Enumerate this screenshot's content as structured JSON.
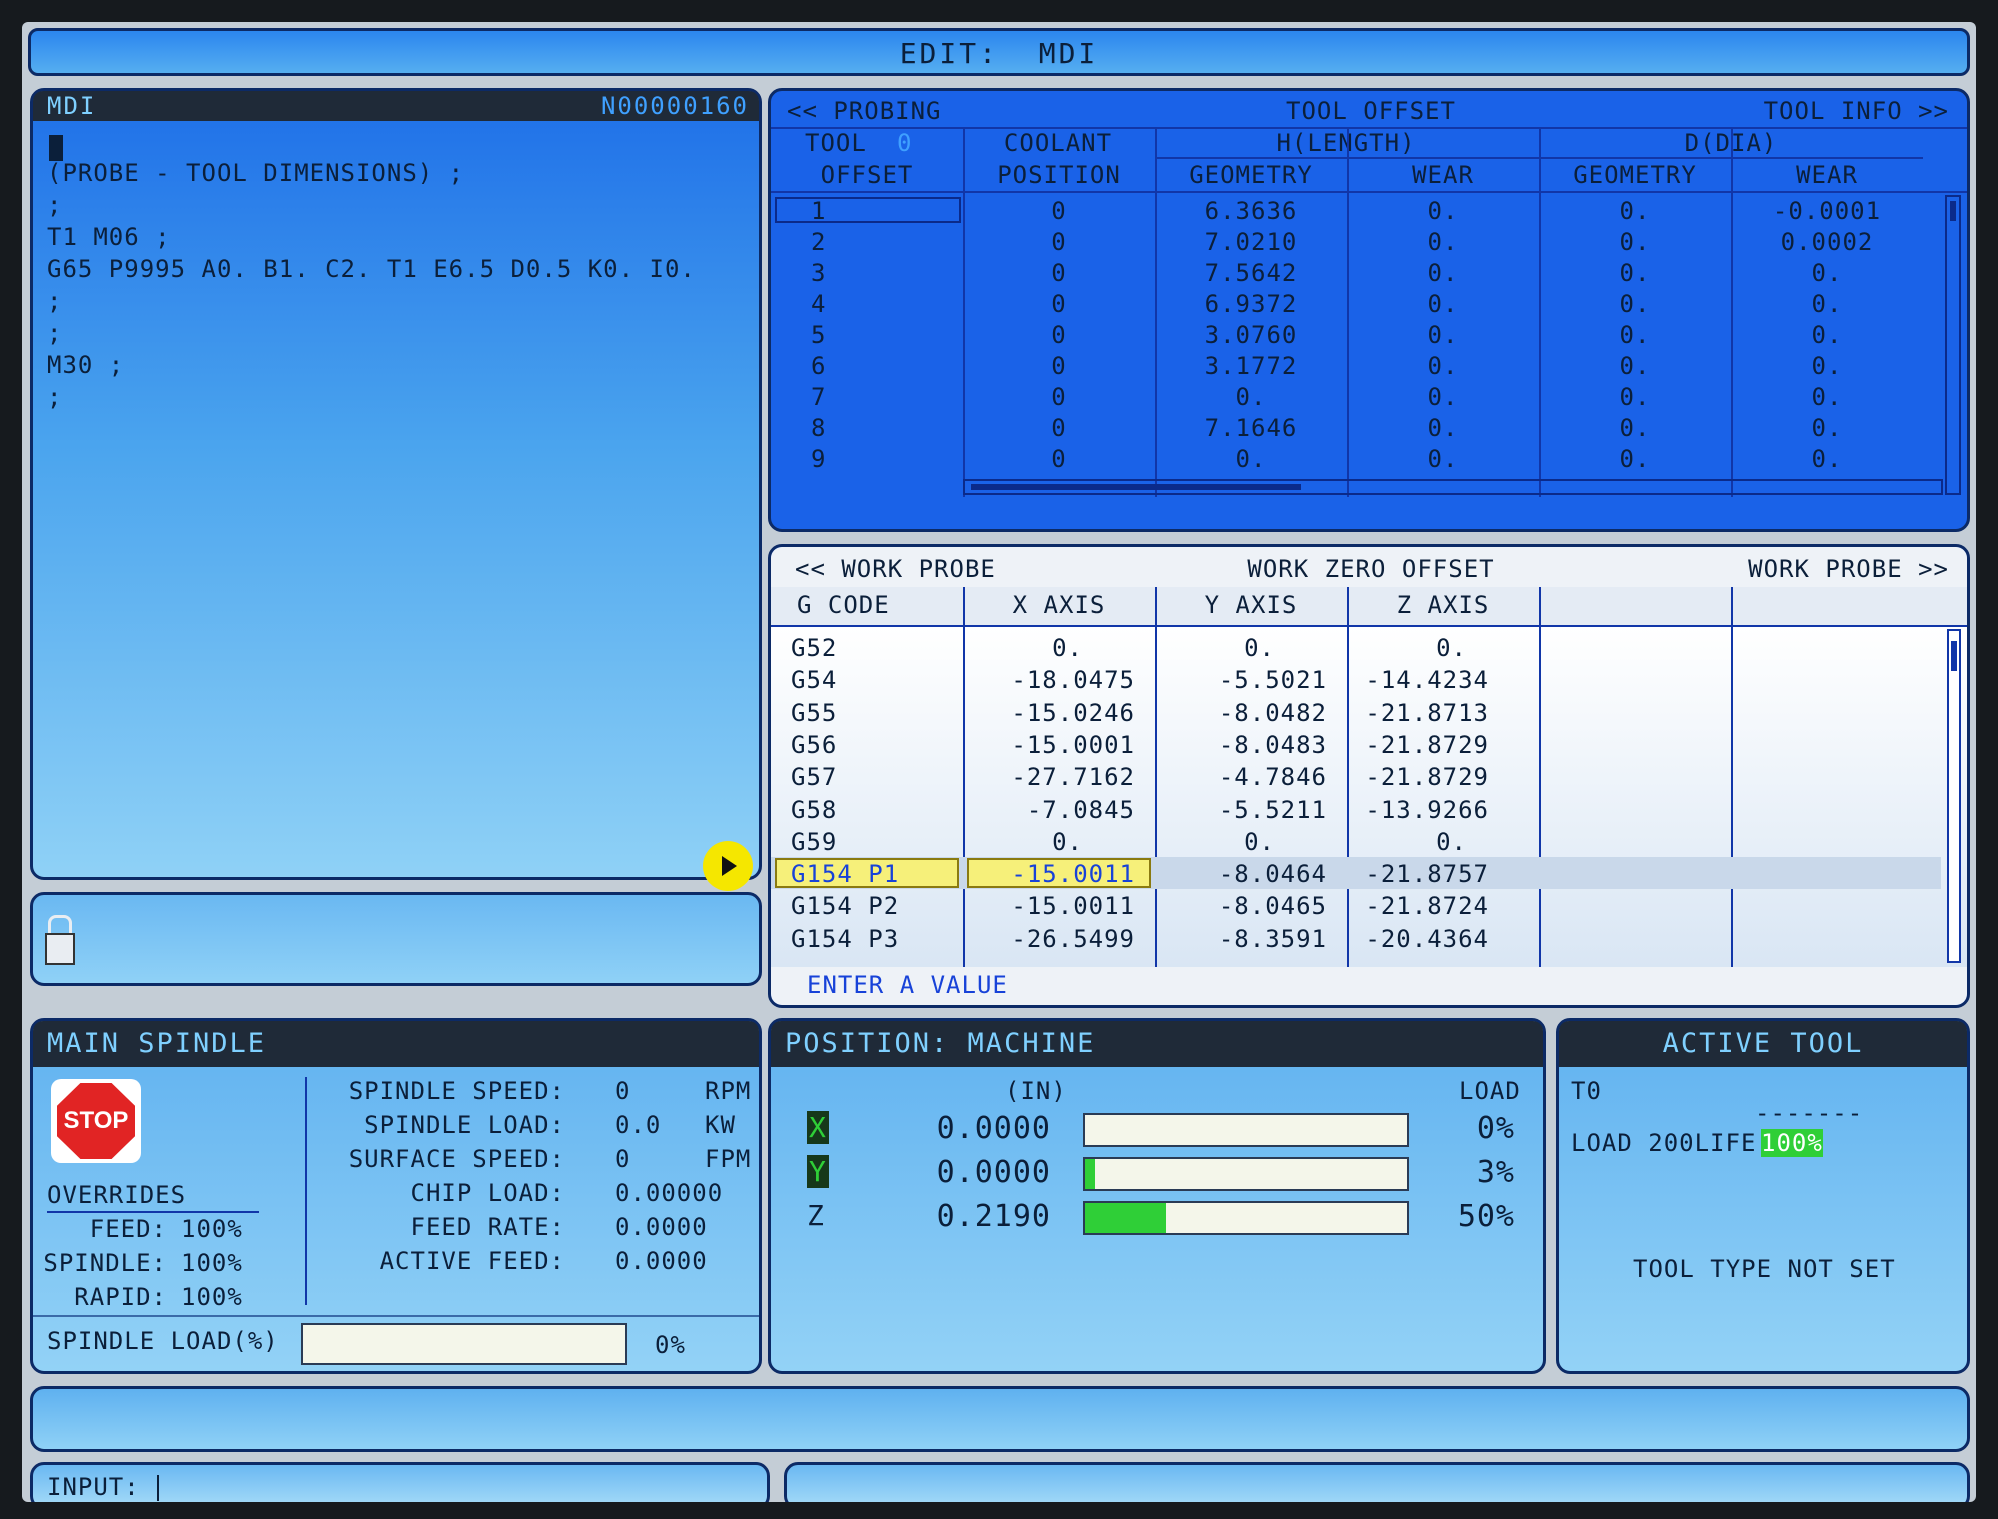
{
  "title": "EDIT:  MDI",
  "mdi": {
    "label": "MDI",
    "program_number": "N00000160",
    "lines": [
      "(PROBE - TOOL DIMENSIONS) ;",
      ";",
      "T1 M06 ;",
      "G65 P9995 A0. B1. C2. T1 E6.5 D0.5 K0. I0.",
      ";",
      ";",
      "M30 ;",
      ";"
    ],
    "play_icon": "play-icon",
    "lock_icon": "lock-icon"
  },
  "tool_offset": {
    "nav_left": "<< PROBING",
    "title": "TOOL OFFSET",
    "nav_right": "TOOL INFO >>",
    "tool_label": "TOOL",
    "tool_value": "0",
    "h_label": "H(LENGTH)",
    "d_label": "D(DIA)",
    "columns": [
      "OFFSET",
      "POSITION",
      "GEOMETRY",
      "WEAR",
      "GEOMETRY",
      "WEAR"
    ],
    "coolant_label": "COOLANT",
    "rows": [
      [
        "1",
        "0",
        "6.3636",
        "0.",
        "0.",
        "-0.0001"
      ],
      [
        "2",
        "0",
        "7.0210",
        "0.",
        "0.",
        "0.0002"
      ],
      [
        "3",
        "0",
        "7.5642",
        "0.",
        "0.",
        "0."
      ],
      [
        "4",
        "0",
        "6.9372",
        "0.",
        "0.",
        "0."
      ],
      [
        "5",
        "0",
        "3.0760",
        "0.",
        "0.",
        "0."
      ],
      [
        "6",
        "0",
        "3.1772",
        "0.",
        "0.",
        "0."
      ],
      [
        "7",
        "0",
        "0.",
        "0.",
        "0.",
        "0."
      ],
      [
        "8",
        "0",
        "7.1646",
        "0.",
        "0.",
        "0."
      ],
      [
        "9",
        "0",
        "0.",
        "0.",
        "0.",
        "0."
      ]
    ]
  },
  "work_offset": {
    "nav_left": "<< WORK PROBE",
    "title": "WORK ZERO OFFSET",
    "nav_right": "WORK PROBE >>",
    "columns": [
      "G CODE",
      "X AXIS",
      "Y AXIS",
      "Z AXIS"
    ],
    "rows": [
      [
        "G52",
        "0.",
        "0.",
        "0."
      ],
      [
        "G54",
        "-18.0475",
        "-5.5021",
        "-14.4234"
      ],
      [
        "G55",
        "-15.0246",
        "-8.0482",
        "-21.8713"
      ],
      [
        "G56",
        "-15.0001",
        "-8.0483",
        "-21.8729"
      ],
      [
        "G57",
        "-27.7162",
        "-4.7846",
        "-21.8729"
      ],
      [
        "G58",
        "-7.0845",
        "-5.5211",
        "-13.9266"
      ],
      [
        "G59",
        "0.",
        "0.",
        "0."
      ],
      [
        "G154 P1",
        "-15.0011",
        "-8.0464",
        "-21.8757"
      ],
      [
        "G154 P2",
        "-15.0011",
        "-8.0465",
        "-21.8724"
      ],
      [
        "G154 P3",
        "-26.5499",
        "-8.3591",
        "-20.4364"
      ]
    ],
    "selected_row": 7,
    "prompt": "ENTER A VALUE"
  },
  "spindle": {
    "title": "MAIN SPINDLE",
    "stop_label": "STOP",
    "overrides_label": "OVERRIDES",
    "overrides": [
      {
        "label": "FEED:",
        "value": "100%"
      },
      {
        "label": "SPINDLE:",
        "value": "100%"
      },
      {
        "label": "RAPID:",
        "value": "100%"
      }
    ],
    "stats": [
      {
        "label": "SPINDLE SPEED:",
        "value": "0",
        "unit": "RPM"
      },
      {
        "label": "SPINDLE LOAD:",
        "value": "0.0",
        "unit": "KW"
      },
      {
        "label": "SURFACE SPEED:",
        "value": "0",
        "unit": "FPM"
      },
      {
        "label": "CHIP LOAD:",
        "value": "0.00000",
        "unit": ""
      },
      {
        "label": "FEED RATE:",
        "value": "0.0000",
        "unit": ""
      },
      {
        "label": "ACTIVE FEED:",
        "value": "0.0000",
        "unit": ""
      }
    ],
    "load_label": "SPINDLE LOAD(%)",
    "load_value": "0%",
    "load_fraction": 0
  },
  "position": {
    "title": "POSITION:  MACHINE",
    "unit_label": "(IN)",
    "load_label": "LOAD",
    "axes": [
      {
        "axis": "X",
        "value": "0.0000",
        "load": "0%",
        "fraction": 0.0,
        "highlight": true
      },
      {
        "axis": "Y",
        "value": "0.0000",
        "load": "3%",
        "fraction": 0.03,
        "highlight": true
      },
      {
        "axis": "Z",
        "value": "0.2190",
        "load": "50%",
        "fraction": 0.25,
        "highlight": false
      }
    ]
  },
  "active_tool": {
    "title": "ACTIVE TOOL",
    "tool": "T0",
    "dashes": "-------",
    "load_text": "LOAD 200LIFE",
    "life": "100%",
    "type_text": "TOOL TYPE NOT SET"
  },
  "input": {
    "label": "INPUT:",
    "value": ""
  },
  "colors": {
    "panel_blue": "#4aa4ee",
    "header_dark": "#1f2a38",
    "highlight_yellow": "#f6f07a",
    "load_green": "#2fcf37"
  }
}
